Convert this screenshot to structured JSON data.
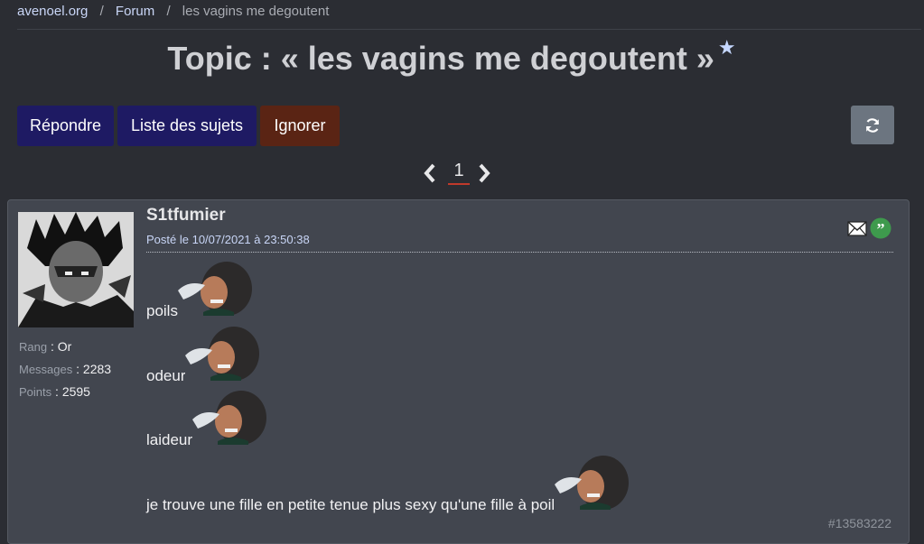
{
  "breadcrumb": {
    "home": "avenoel.org",
    "forum": "Forum",
    "current": "les vagins me degoutent",
    "separator": "/"
  },
  "title": {
    "text": "Topic : « les vagins me degoutent »",
    "star_icon": "star-icon"
  },
  "toolbar": {
    "reply_label": "Répondre",
    "list_label": "Liste des sujets",
    "ignore_label": "Ignorer",
    "refresh_icon": "refresh-icon"
  },
  "pagination": {
    "current_page": "1",
    "prev_icon": "chevron-left-icon",
    "next_icon": "chevron-right-icon"
  },
  "post": {
    "author": "S1tfumier",
    "date": "Posté le 10/07/2021 à 23:50:38",
    "stats": [
      {
        "key": "Rang",
        "sep": " : ",
        "value": "Or"
      },
      {
        "key": "Messages",
        "sep": " : ",
        "value": "2283"
      },
      {
        "key": "Points",
        "sep": " : ",
        "value": "2595"
      }
    ],
    "lines": [
      "poils",
      "odeur",
      "laideur",
      "je trouve une fille en petite tenue plus sexy qu'une fille à poil"
    ],
    "id": "#13583222",
    "mail_icon": "mail-icon",
    "quote_icon": "quote-icon"
  },
  "colors": {
    "background": "#2b2d33",
    "post_bg": "#42464f",
    "button_primary": "#1e1a63",
    "button_danger": "#5a2414",
    "button_refresh": "#6c7580",
    "link": "#c9d6f7"
  }
}
